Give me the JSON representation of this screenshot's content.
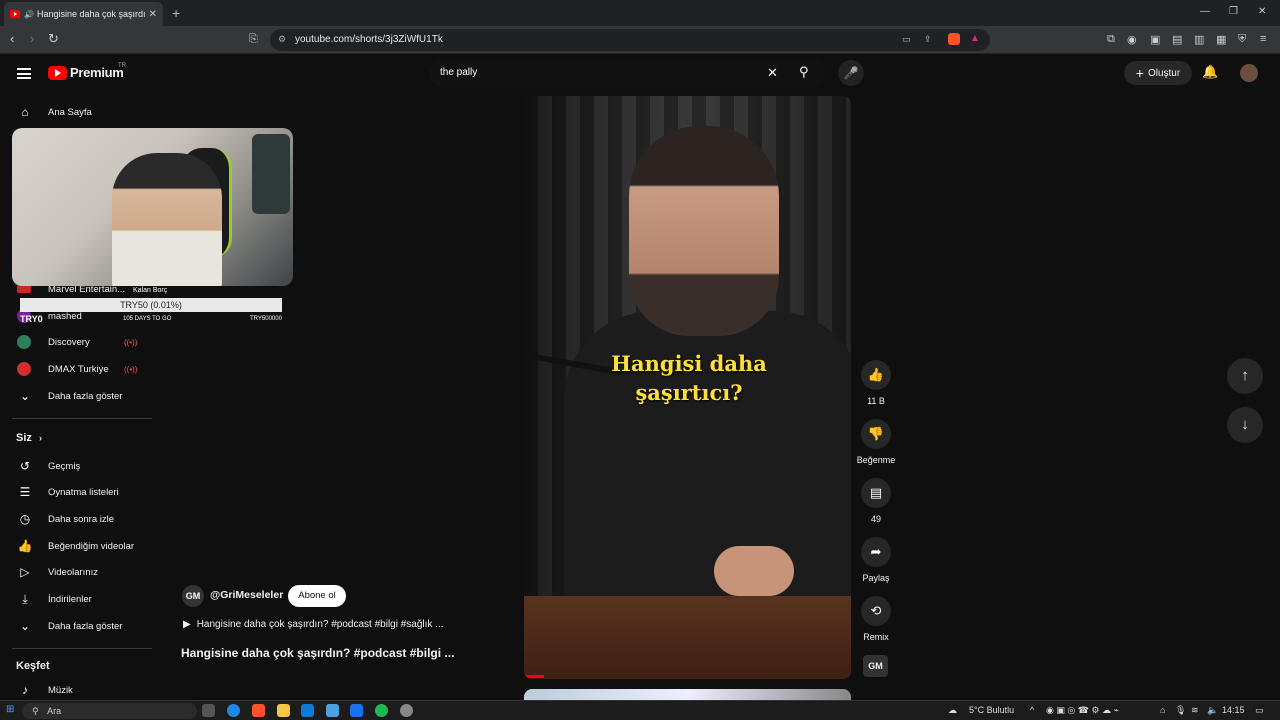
{
  "browser": {
    "tab_title": "Hangisine daha çok şaşırdın?",
    "url": "youtube.com/shorts/3j3ZiWfU1Tk"
  },
  "header": {
    "logo_text": "Premium",
    "logo_region": "TR",
    "search_query": "the pally",
    "create_label": "Oluştur"
  },
  "sidebar": {
    "home": "Ana Sayfa",
    "subscriptions": [
      {
        "label": "Marvel Entertain...",
        "color": "#c62828"
      },
      {
        "label": "mashed",
        "color": "#7b1fa2"
      },
      {
        "label": "Discovery",
        "color": "#2e7d5b",
        "live": "((•))"
      },
      {
        "label": "DMAX Turkiye",
        "color": "#d32f2f",
        "live": "((•))"
      }
    ],
    "show_more_1": "Daha fazla göster",
    "you_heading": "Siz",
    "you_items": [
      {
        "label": "Geçmiş",
        "icon": "history-icon"
      },
      {
        "label": "Oynatma listeleri",
        "icon": "playlist-icon"
      },
      {
        "label": "Daha sonra izle",
        "icon": "clock-icon"
      },
      {
        "label": "Beğendiğim videolar",
        "icon": "thumbs-up-icon"
      },
      {
        "label": "Videolarınız",
        "icon": "video-icon"
      },
      {
        "label": "İndirilenler",
        "icon": "download-icon"
      }
    ],
    "show_more_2": "Daha fazla göster",
    "explore_heading": "Keşfet",
    "music": "Müzik"
  },
  "overlay": {
    "donation_bar": "TRY50 (0.01%)",
    "remaining": "Kalan Borç",
    "currency": "TRY0",
    "days": "105 DAYS TO GO",
    "goal": "TRY500000"
  },
  "video": {
    "caption_line1": "Hangisi daha",
    "caption_line2": "şaşırtıcı?",
    "channel": "@GriMeseleler",
    "channel_initials": "GM",
    "subscribe": "Abone ol",
    "music_row": "Hangisine daha çok şaşırdın? #podcast #bilgi #sağlık ...",
    "title": "Hangisine daha çok şaşırdın? #podcast #bilgi ..."
  },
  "actions": {
    "likes": "11 B",
    "dislike": "Beğenme",
    "comments": "49",
    "share": "Paylaş",
    "remix": "Remix"
  },
  "taskbar": {
    "search_placeholder": "Ara",
    "weather": "5°C  Bulutlu",
    "time": "14:15"
  }
}
